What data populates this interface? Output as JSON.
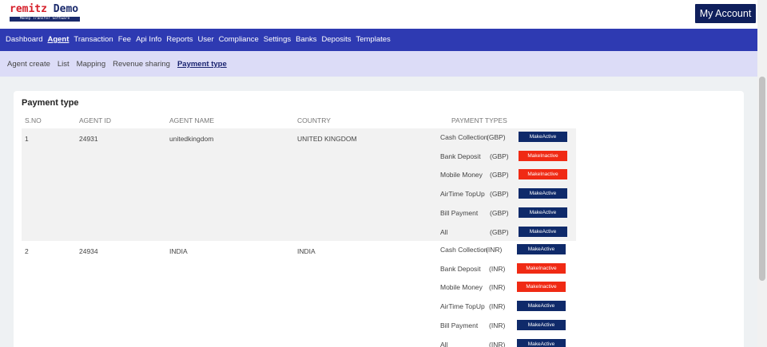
{
  "brand": {
    "name_red": "remitz",
    "name_blue": " Demo",
    "tagline": "Money Transfer Software"
  },
  "header": {
    "account_label": "My Account"
  },
  "main_nav": [
    {
      "label": "Dashboard",
      "active": false
    },
    {
      "label": "Agent",
      "active": true
    },
    {
      "label": "Transaction",
      "active": false
    },
    {
      "label": "Fee",
      "active": false
    },
    {
      "label": "Api Info",
      "active": false
    },
    {
      "label": "Reports",
      "active": false
    },
    {
      "label": "User",
      "active": false
    },
    {
      "label": "Compliance",
      "active": false
    },
    {
      "label": "Settings",
      "active": false
    },
    {
      "label": "Banks",
      "active": false
    },
    {
      "label": "Deposits",
      "active": false
    },
    {
      "label": "Templates",
      "active": false
    }
  ],
  "sub_nav": [
    {
      "label": "Agent create",
      "active": false
    },
    {
      "label": "List",
      "active": false
    },
    {
      "label": "Mapping",
      "active": false
    },
    {
      "label": "Revenue sharing",
      "active": false
    },
    {
      "label": "Payment type",
      "active": true
    }
  ],
  "page": {
    "title": "Payment type"
  },
  "table": {
    "headers": {
      "sno": "S.NO",
      "agent_id": "AGENT ID",
      "agent_name": "AGENT NAME",
      "country": "COUNTRY",
      "payment_types": "PAYMENT TYPES"
    },
    "rows": [
      {
        "sno": "1",
        "agent_id": "24931",
        "agent_name": "unitedkingdom",
        "country": "UNITED KINGDOM",
        "payment_types": [
          {
            "name": "Cash Collection",
            "currency": "(GBP)",
            "button": "MakeActive",
            "status": "active"
          },
          {
            "name": "Bank Deposit",
            "currency": "(GBP)",
            "button": "MakeInactive",
            "status": "inactive"
          },
          {
            "name": "Mobile Money",
            "currency": "(GBP)",
            "button": "MakeInactive",
            "status": "inactive"
          },
          {
            "name": "AirTime TopUp",
            "currency": "(GBP)",
            "button": "MakeActive",
            "status": "active"
          },
          {
            "name": "Bill Payment",
            "currency": "(GBP)",
            "button": "MakeActive",
            "status": "active"
          },
          {
            "name": "All",
            "currency": "(GBP)",
            "button": "MakeActive",
            "status": "active"
          }
        ]
      },
      {
        "sno": "2",
        "agent_id": "24934",
        "agent_name": "INDIA",
        "country": "INDIA",
        "payment_types": [
          {
            "name": "Cash Collection",
            "currency": "(INR)",
            "button": "MakeActive",
            "status": "active"
          },
          {
            "name": "Bank Deposit",
            "currency": "(INR)",
            "button": "MakeInactive",
            "status": "inactive"
          },
          {
            "name": "Mobile Money",
            "currency": "(INR)",
            "button": "MakeInactive",
            "status": "inactive"
          },
          {
            "name": "AirTime TopUp",
            "currency": "(INR)",
            "button": "MakeActive",
            "status": "active"
          },
          {
            "name": "Bill Payment",
            "currency": "(INR)",
            "button": "MakeActive",
            "status": "active"
          },
          {
            "name": "All",
            "currency": "(INR)",
            "button": "MakeActive",
            "status": "active"
          }
        ]
      }
    ]
  },
  "colors": {
    "nav_bg": "#2e3ab2",
    "subnav_bg": "#dcdcf7",
    "active_btn": "#0f2a6a",
    "inactive_btn": "#f02a14",
    "account_btn": "#0f1f5c"
  }
}
